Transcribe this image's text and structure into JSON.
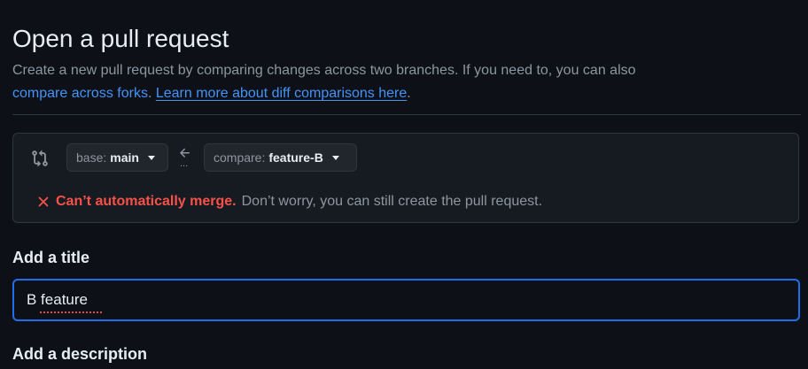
{
  "header": {
    "title": "Open a pull request",
    "description_prefix": "Create a new pull request by comparing changes across two branches. If you need to, you can also",
    "compare_forks_link": "compare across forks",
    "separator": ".",
    "learn_more_link": "Learn more about diff comparisons here",
    "end_period": "."
  },
  "compare": {
    "base_prefix": "base:",
    "base_branch": "main",
    "compare_prefix": "compare:",
    "compare_branch": "feature-B",
    "ellipsis": "...",
    "merge_error": "Can’t automatically merge.",
    "merge_note": "Don’t worry, you can still create the pull request."
  },
  "form": {
    "title_label": "Add a title",
    "title_value": "B feature",
    "description_label": "Add a description"
  },
  "colors": {
    "background": "#0d1117",
    "panel": "#161b22",
    "border": "#30363d",
    "link": "#4493f8",
    "error": "#f85149",
    "focus": "#1f6feb"
  },
  "icons": {
    "compare": "git-compare-icon",
    "arrow": "arrow-left-icon",
    "error": "x-icon",
    "dropdown": "triangle-down-icon"
  }
}
